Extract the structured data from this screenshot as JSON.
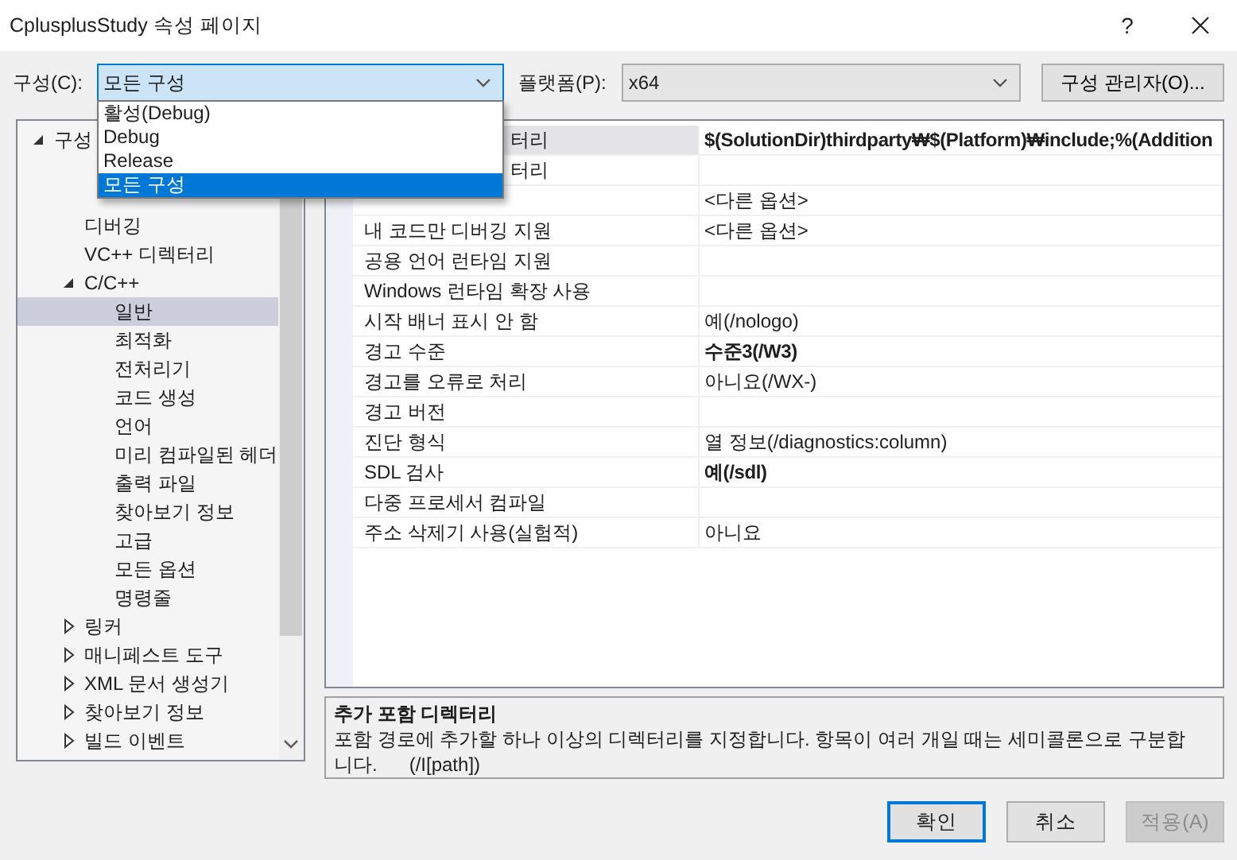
{
  "window": {
    "title": "CplusplusStudy 속성 페이지",
    "help": "?"
  },
  "toolbar": {
    "config_label": "구성(C):",
    "config_value": "모든 구성",
    "config_options": [
      {
        "label": "활성(Debug)",
        "selected": false
      },
      {
        "label": "Debug",
        "selected": false
      },
      {
        "label": "Release",
        "selected": false
      },
      {
        "label": "모든 구성",
        "selected": true
      }
    ],
    "platform_label": "플랫폼(P):",
    "platform_value": "x64",
    "manager_button": "구성 관리자(O)..."
  },
  "tree": [
    {
      "label": "구성",
      "expanded": true,
      "selected": false,
      "children": [
        {
          "selected": false
        },
        {
          "selected": false
        },
        {
          "label": "디버깅",
          "selected": false
        },
        {
          "label": "VC++ 디렉터리",
          "selected": false
        },
        {
          "label": "C/C++",
          "expanded": true,
          "selected": false,
          "children": [
            {
              "label": "일반",
              "selected": true
            },
            {
              "label": "최적화",
              "selected": false
            },
            {
              "label": "전처리기",
              "selected": false
            },
            {
              "label": "코드 생성",
              "selected": false
            },
            {
              "label": "언어",
              "selected": false
            },
            {
              "label": "미리 컴파일된 헤더",
              "selected": false
            },
            {
              "label": "출력 파일",
              "selected": false
            },
            {
              "label": "찾아보기 정보",
              "selected": false
            },
            {
              "label": "고급",
              "selected": false
            },
            {
              "label": "모든 옵션",
              "selected": false
            },
            {
              "label": "명령줄",
              "selected": false
            }
          ]
        },
        {
          "label": "링커",
          "expanded": false,
          "selected": false
        },
        {
          "label": "매니페스트 도구",
          "expanded": false,
          "selected": false
        },
        {
          "label": "XML 문서 생성기",
          "expanded": false,
          "selected": false
        },
        {
          "label": "찾아보기 정보",
          "expanded": false,
          "selected": false
        },
        {
          "label": "빌드 이벤트",
          "expanded": false,
          "selected": false
        }
      ]
    }
  ],
  "properties": [
    {
      "name": "터리",
      "kind": "tail",
      "value": "$(SolutionDir)thirdparty₩$(Platform)₩include;%(Addition",
      "bold": true,
      "selected": true
    },
    {
      "name": "터리",
      "kind": "tail",
      "selected": false
    },
    {
      "value": "<다른 옵션>",
      "bold": false,
      "selected": false
    },
    {
      "name": "내 코드만 디버깅 지원",
      "value": "<다른 옵션>",
      "bold": false,
      "selected": false
    },
    {
      "name": "공용 언어 런타임 지원",
      "selected": false
    },
    {
      "name": "Windows 런타임 확장 사용",
      "selected": false
    },
    {
      "name": "시작 배너 표시 안 함",
      "value": "예(/nologo)",
      "bold": false,
      "selected": false
    },
    {
      "name": "경고 수준",
      "value": "수준3(/W3)",
      "bold": true,
      "selected": false
    },
    {
      "name": "경고를 오류로 처리",
      "value": "아니요(/WX-)",
      "bold": false,
      "selected": false
    },
    {
      "name": "경고 버전",
      "selected": false
    },
    {
      "name": "진단 형식",
      "value": "열 정보(/diagnostics:column)",
      "bold": false,
      "selected": false
    },
    {
      "name": "SDL 검사",
      "value": "예(/sdl)",
      "bold": true,
      "selected": false
    },
    {
      "name": "다중 프로세서 컴파일",
      "selected": false
    },
    {
      "name": "주소 삭제기 사용(실험적)",
      "value": "아니요",
      "bold": false,
      "selected": false
    }
  ],
  "description": {
    "title": "추가 포함 디렉터리",
    "text": "포함 경로에 추가할 하나 이상의 디렉터리를 지정합니다. 항목이 여러 개일 때는 세미콜론으로 구분합니다.      (/I[path])"
  },
  "buttons": [
    {
      "label": "확인",
      "kind": "default",
      "disabled": false
    },
    {
      "label": "취소",
      "kind": "normal",
      "disabled": false
    },
    {
      "label": "적용(A)",
      "kind": "normal",
      "disabled": true
    }
  ]
}
